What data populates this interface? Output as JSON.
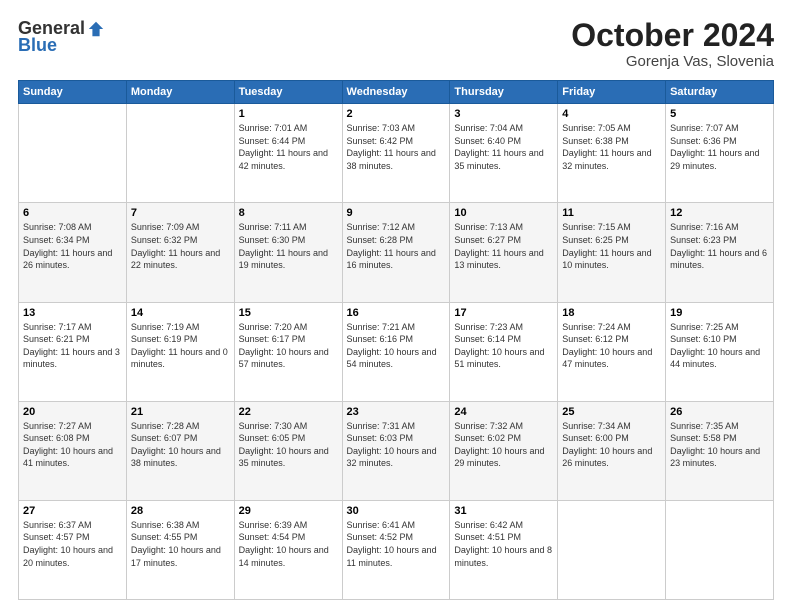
{
  "logo": {
    "general": "General",
    "blue": "Blue"
  },
  "header": {
    "month": "October 2024",
    "location": "Gorenja Vas, Slovenia"
  },
  "weekdays": [
    "Sunday",
    "Monday",
    "Tuesday",
    "Wednesday",
    "Thursday",
    "Friday",
    "Saturday"
  ],
  "weeks": [
    [
      {
        "day": "",
        "sunrise": "",
        "sunset": "",
        "daylight": ""
      },
      {
        "day": "",
        "sunrise": "",
        "sunset": "",
        "daylight": ""
      },
      {
        "day": "1",
        "sunrise": "Sunrise: 7:01 AM",
        "sunset": "Sunset: 6:44 PM",
        "daylight": "Daylight: 11 hours and 42 minutes."
      },
      {
        "day": "2",
        "sunrise": "Sunrise: 7:03 AM",
        "sunset": "Sunset: 6:42 PM",
        "daylight": "Daylight: 11 hours and 38 minutes."
      },
      {
        "day": "3",
        "sunrise": "Sunrise: 7:04 AM",
        "sunset": "Sunset: 6:40 PM",
        "daylight": "Daylight: 11 hours and 35 minutes."
      },
      {
        "day": "4",
        "sunrise": "Sunrise: 7:05 AM",
        "sunset": "Sunset: 6:38 PM",
        "daylight": "Daylight: 11 hours and 32 minutes."
      },
      {
        "day": "5",
        "sunrise": "Sunrise: 7:07 AM",
        "sunset": "Sunset: 6:36 PM",
        "daylight": "Daylight: 11 hours and 29 minutes."
      }
    ],
    [
      {
        "day": "6",
        "sunrise": "Sunrise: 7:08 AM",
        "sunset": "Sunset: 6:34 PM",
        "daylight": "Daylight: 11 hours and 26 minutes."
      },
      {
        "day": "7",
        "sunrise": "Sunrise: 7:09 AM",
        "sunset": "Sunset: 6:32 PM",
        "daylight": "Daylight: 11 hours and 22 minutes."
      },
      {
        "day": "8",
        "sunrise": "Sunrise: 7:11 AM",
        "sunset": "Sunset: 6:30 PM",
        "daylight": "Daylight: 11 hours and 19 minutes."
      },
      {
        "day": "9",
        "sunrise": "Sunrise: 7:12 AM",
        "sunset": "Sunset: 6:28 PM",
        "daylight": "Daylight: 11 hours and 16 minutes."
      },
      {
        "day": "10",
        "sunrise": "Sunrise: 7:13 AM",
        "sunset": "Sunset: 6:27 PM",
        "daylight": "Daylight: 11 hours and 13 minutes."
      },
      {
        "day": "11",
        "sunrise": "Sunrise: 7:15 AM",
        "sunset": "Sunset: 6:25 PM",
        "daylight": "Daylight: 11 hours and 10 minutes."
      },
      {
        "day": "12",
        "sunrise": "Sunrise: 7:16 AM",
        "sunset": "Sunset: 6:23 PM",
        "daylight": "Daylight: 11 hours and 6 minutes."
      }
    ],
    [
      {
        "day": "13",
        "sunrise": "Sunrise: 7:17 AM",
        "sunset": "Sunset: 6:21 PM",
        "daylight": "Daylight: 11 hours and 3 minutes."
      },
      {
        "day": "14",
        "sunrise": "Sunrise: 7:19 AM",
        "sunset": "Sunset: 6:19 PM",
        "daylight": "Daylight: 11 hours and 0 minutes."
      },
      {
        "day": "15",
        "sunrise": "Sunrise: 7:20 AM",
        "sunset": "Sunset: 6:17 PM",
        "daylight": "Daylight: 10 hours and 57 minutes."
      },
      {
        "day": "16",
        "sunrise": "Sunrise: 7:21 AM",
        "sunset": "Sunset: 6:16 PM",
        "daylight": "Daylight: 10 hours and 54 minutes."
      },
      {
        "day": "17",
        "sunrise": "Sunrise: 7:23 AM",
        "sunset": "Sunset: 6:14 PM",
        "daylight": "Daylight: 10 hours and 51 minutes."
      },
      {
        "day": "18",
        "sunrise": "Sunrise: 7:24 AM",
        "sunset": "Sunset: 6:12 PM",
        "daylight": "Daylight: 10 hours and 47 minutes."
      },
      {
        "day": "19",
        "sunrise": "Sunrise: 7:25 AM",
        "sunset": "Sunset: 6:10 PM",
        "daylight": "Daylight: 10 hours and 44 minutes."
      }
    ],
    [
      {
        "day": "20",
        "sunrise": "Sunrise: 7:27 AM",
        "sunset": "Sunset: 6:08 PM",
        "daylight": "Daylight: 10 hours and 41 minutes."
      },
      {
        "day": "21",
        "sunrise": "Sunrise: 7:28 AM",
        "sunset": "Sunset: 6:07 PM",
        "daylight": "Daylight: 10 hours and 38 minutes."
      },
      {
        "day": "22",
        "sunrise": "Sunrise: 7:30 AM",
        "sunset": "Sunset: 6:05 PM",
        "daylight": "Daylight: 10 hours and 35 minutes."
      },
      {
        "day": "23",
        "sunrise": "Sunrise: 7:31 AM",
        "sunset": "Sunset: 6:03 PM",
        "daylight": "Daylight: 10 hours and 32 minutes."
      },
      {
        "day": "24",
        "sunrise": "Sunrise: 7:32 AM",
        "sunset": "Sunset: 6:02 PM",
        "daylight": "Daylight: 10 hours and 29 minutes."
      },
      {
        "day": "25",
        "sunrise": "Sunrise: 7:34 AM",
        "sunset": "Sunset: 6:00 PM",
        "daylight": "Daylight: 10 hours and 26 minutes."
      },
      {
        "day": "26",
        "sunrise": "Sunrise: 7:35 AM",
        "sunset": "Sunset: 5:58 PM",
        "daylight": "Daylight: 10 hours and 23 minutes."
      }
    ],
    [
      {
        "day": "27",
        "sunrise": "Sunrise: 6:37 AM",
        "sunset": "Sunset: 4:57 PM",
        "daylight": "Daylight: 10 hours and 20 minutes."
      },
      {
        "day": "28",
        "sunrise": "Sunrise: 6:38 AM",
        "sunset": "Sunset: 4:55 PM",
        "daylight": "Daylight: 10 hours and 17 minutes."
      },
      {
        "day": "29",
        "sunrise": "Sunrise: 6:39 AM",
        "sunset": "Sunset: 4:54 PM",
        "daylight": "Daylight: 10 hours and 14 minutes."
      },
      {
        "day": "30",
        "sunrise": "Sunrise: 6:41 AM",
        "sunset": "Sunset: 4:52 PM",
        "daylight": "Daylight: 10 hours and 11 minutes."
      },
      {
        "day": "31",
        "sunrise": "Sunrise: 6:42 AM",
        "sunset": "Sunset: 4:51 PM",
        "daylight": "Daylight: 10 hours and 8 minutes."
      },
      {
        "day": "",
        "sunrise": "",
        "sunset": "",
        "daylight": ""
      },
      {
        "day": "",
        "sunrise": "",
        "sunset": "",
        "daylight": ""
      }
    ]
  ]
}
